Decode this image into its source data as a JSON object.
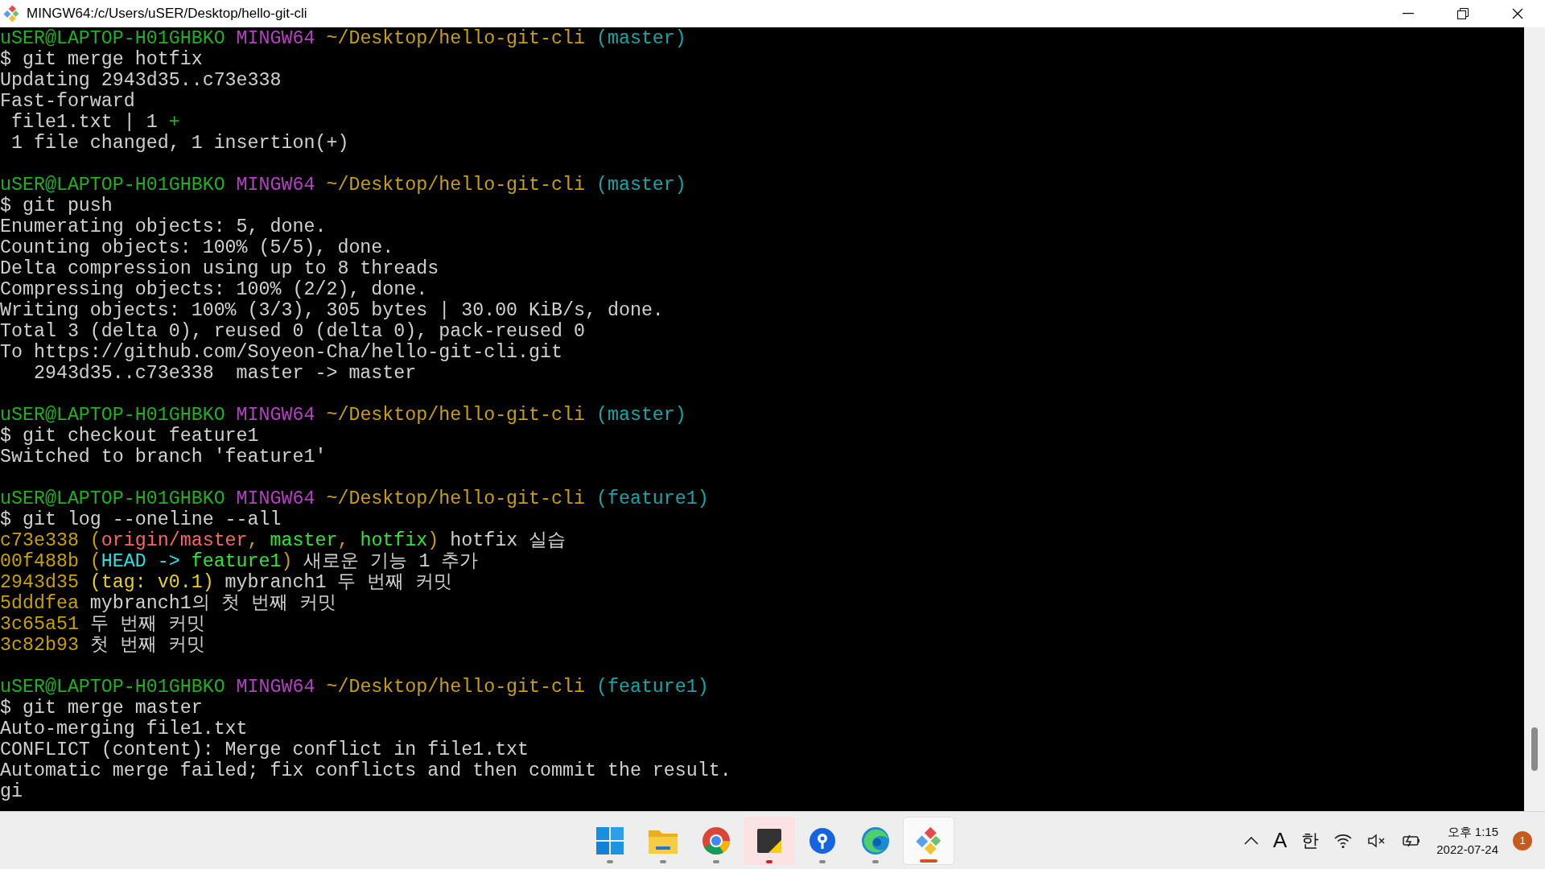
{
  "window": {
    "title": "MINGW64:/c/Users/uSER/Desktop/hello-git-cli"
  },
  "terminal": {
    "lines": [
      {
        "kind": "text",
        "segments": [
          {
            "text": "uSER@LAPTOP-H01GHBKO ",
            "color": "#1db31d"
          },
          {
            "text": "MINGW64 ",
            "color": "#b93ec6"
          },
          {
            "text": "~/Desktop/hello-git-cli ",
            "color": "#c8a100"
          },
          {
            "text": "(master)",
            "color": "#13a8a8"
          }
        ]
      },
      {
        "kind": "text",
        "segments": [
          {
            "text": "$ git merge hotfix",
            "color": "#d0d0d0"
          }
        ]
      },
      {
        "kind": "text",
        "segments": [
          {
            "text": "Updating 2943d35..c73e338",
            "color": "#d0d0d0"
          }
        ]
      },
      {
        "kind": "text",
        "segments": [
          {
            "text": "Fast-forward",
            "color": "#d0d0d0"
          }
        ]
      },
      {
        "kind": "text",
        "segments": [
          {
            "text": " file1.txt | 1 ",
            "color": "#d0d0d0"
          },
          {
            "text": "+",
            "color": "#1db31d"
          }
        ]
      },
      {
        "kind": "text",
        "segments": [
          {
            "text": " 1 file changed, 1 insertion(+)",
            "color": "#d0d0d0"
          }
        ]
      },
      {
        "kind": "blank"
      },
      {
        "kind": "text",
        "segments": [
          {
            "text": "uSER@LAPTOP-H01GHBKO ",
            "color": "#1db31d"
          },
          {
            "text": "MINGW64 ",
            "color": "#b93ec6"
          },
          {
            "text": "~/Desktop/hello-git-cli ",
            "color": "#c8a100"
          },
          {
            "text": "(master)",
            "color": "#13a8a8"
          }
        ]
      },
      {
        "kind": "text",
        "segments": [
          {
            "text": "$ git push",
            "color": "#d0d0d0"
          }
        ]
      },
      {
        "kind": "text",
        "segments": [
          {
            "text": "Enumerating objects: 5, done.",
            "color": "#d0d0d0"
          }
        ]
      },
      {
        "kind": "text",
        "segments": [
          {
            "text": "Counting objects: 100% (5/5), done.",
            "color": "#d0d0d0"
          }
        ]
      },
      {
        "kind": "text",
        "segments": [
          {
            "text": "Delta compression using up to 8 threads",
            "color": "#d0d0d0"
          }
        ]
      },
      {
        "kind": "text",
        "segments": [
          {
            "text": "Compressing objects: 100% (2/2), done.",
            "color": "#d0d0d0"
          }
        ]
      },
      {
        "kind": "text",
        "segments": [
          {
            "text": "Writing objects: 100% (3/3), 305 bytes | 30.00 KiB/s, done.",
            "color": "#d0d0d0"
          }
        ]
      },
      {
        "kind": "text",
        "segments": [
          {
            "text": "Total 3 (delta 0), reused 0 (delta 0), pack-reused 0",
            "color": "#d0d0d0"
          }
        ]
      },
      {
        "kind": "text",
        "segments": [
          {
            "text": "To https://github.com/Soyeon-Cha/hello-git-cli.git",
            "color": "#d0d0d0"
          }
        ]
      },
      {
        "kind": "text",
        "segments": [
          {
            "text": "   2943d35..c73e338  master -> master",
            "color": "#d0d0d0"
          }
        ]
      },
      {
        "kind": "blank"
      },
      {
        "kind": "text",
        "segments": [
          {
            "text": "uSER@LAPTOP-H01GHBKO ",
            "color": "#1db31d"
          },
          {
            "text": "MINGW64 ",
            "color": "#b93ec6"
          },
          {
            "text": "~/Desktop/hello-git-cli ",
            "color": "#c8a100"
          },
          {
            "text": "(master)",
            "color": "#13a8a8"
          }
        ]
      },
      {
        "kind": "text",
        "segments": [
          {
            "text": "$ git checkout feature1",
            "color": "#d0d0d0"
          }
        ]
      },
      {
        "kind": "text",
        "segments": [
          {
            "text": "Switched to branch 'feature1'",
            "color": "#d0d0d0"
          }
        ]
      },
      {
        "kind": "blank"
      },
      {
        "kind": "text",
        "segments": [
          {
            "text": "uSER@LAPTOP-H01GHBKO ",
            "color": "#1db31d"
          },
          {
            "text": "MINGW64 ",
            "color": "#b93ec6"
          },
          {
            "text": "~/Desktop/hello-git-cli ",
            "color": "#c8a100"
          },
          {
            "text": "(feature1)",
            "color": "#13a8a8"
          }
        ]
      },
      {
        "kind": "text",
        "segments": [
          {
            "text": "$ git log --oneline --all",
            "color": "#d0d0d0"
          }
        ]
      },
      {
        "kind": "text",
        "segments": [
          {
            "text": "c73e338 ",
            "color": "#c8a100"
          },
          {
            "text": "(",
            "color": "#c8a100"
          },
          {
            "text": "origin/master",
            "color": "#ff6464"
          },
          {
            "text": ", ",
            "color": "#c8a100"
          },
          {
            "text": "master",
            "color": "#2bea2b"
          },
          {
            "text": ", ",
            "color": "#c8a100"
          },
          {
            "text": "hotfix",
            "color": "#2bea2b"
          },
          {
            "text": ")",
            "color": "#c8a100"
          },
          {
            "text": " hotfix 실습",
            "color": "#d0d0d0"
          }
        ]
      },
      {
        "kind": "text",
        "segments": [
          {
            "text": "00f488b ",
            "color": "#c8a100"
          },
          {
            "text": "(",
            "color": "#c8a100"
          },
          {
            "text": "HEAD -> ",
            "color": "#22e6e6"
          },
          {
            "text": "feature1",
            "color": "#2bea2b"
          },
          {
            "text": ")",
            "color": "#c8a100"
          },
          {
            "text": " 새로운 기능 1 추가",
            "color": "#d0d0d0"
          }
        ]
      },
      {
        "kind": "text",
        "segments": [
          {
            "text": "2943d35 ",
            "color": "#c8a100"
          },
          {
            "text": "(tag: v0.1)",
            "color": "#e8d21a"
          },
          {
            "text": " mybranch1 두 번째 커밋",
            "color": "#d0d0d0"
          }
        ]
      },
      {
        "kind": "text",
        "segments": [
          {
            "text": "5dddfea ",
            "color": "#c8a100"
          },
          {
            "text": "mybranch1의 첫 번째 커밋",
            "color": "#d0d0d0"
          }
        ]
      },
      {
        "kind": "text",
        "segments": [
          {
            "text": "3c65a51 ",
            "color": "#c8a100"
          },
          {
            "text": "두 번째 커밋",
            "color": "#d0d0d0"
          }
        ]
      },
      {
        "kind": "text",
        "segments": [
          {
            "text": "3c82b93 ",
            "color": "#c8a100"
          },
          {
            "text": "첫 번째 커밋",
            "color": "#d0d0d0"
          }
        ]
      },
      {
        "kind": "blank"
      },
      {
        "kind": "text",
        "segments": [
          {
            "text": "uSER@LAPTOP-H01GHBKO ",
            "color": "#1db31d"
          },
          {
            "text": "MINGW64 ",
            "color": "#b93ec6"
          },
          {
            "text": "~/Desktop/hello-git-cli ",
            "color": "#c8a100"
          },
          {
            "text": "(feature1)",
            "color": "#13a8a8"
          }
        ]
      },
      {
        "kind": "text",
        "segments": [
          {
            "text": "$ git merge master",
            "color": "#d0d0d0"
          }
        ]
      },
      {
        "kind": "text",
        "segments": [
          {
            "text": "Auto-merging file1.txt",
            "color": "#d0d0d0"
          }
        ]
      },
      {
        "kind": "text",
        "segments": [
          {
            "text": "CONFLICT (content): Merge conflict in file1.txt",
            "color": "#d0d0d0"
          }
        ]
      },
      {
        "kind": "text",
        "segments": [
          {
            "text": "Automatic merge failed; fix conflicts and then commit the result.",
            "color": "#d0d0d0"
          }
        ]
      },
      {
        "kind": "text",
        "segments": [
          {
            "text": "gi",
            "color": "#d0d0d0"
          }
        ]
      }
    ]
  },
  "taskbar": {
    "apps": [
      {
        "kind": "start",
        "selected": false,
        "attention": false
      },
      {
        "kind": "folder",
        "selected": false,
        "attention": false
      },
      {
        "kind": "chrome",
        "selected": false,
        "attention": false
      },
      {
        "kind": "notes",
        "selected": false,
        "attention": true
      },
      {
        "kind": "pin",
        "selected": false,
        "attention": false
      },
      {
        "kind": "edge",
        "selected": false,
        "attention": false
      },
      {
        "kind": "git",
        "selected": true,
        "attention": false
      }
    ],
    "tray": {
      "ime_mode": "A",
      "ime_lang": "한",
      "time": "오후 1:15",
      "date": "2022-07-24",
      "badge": "1"
    }
  }
}
